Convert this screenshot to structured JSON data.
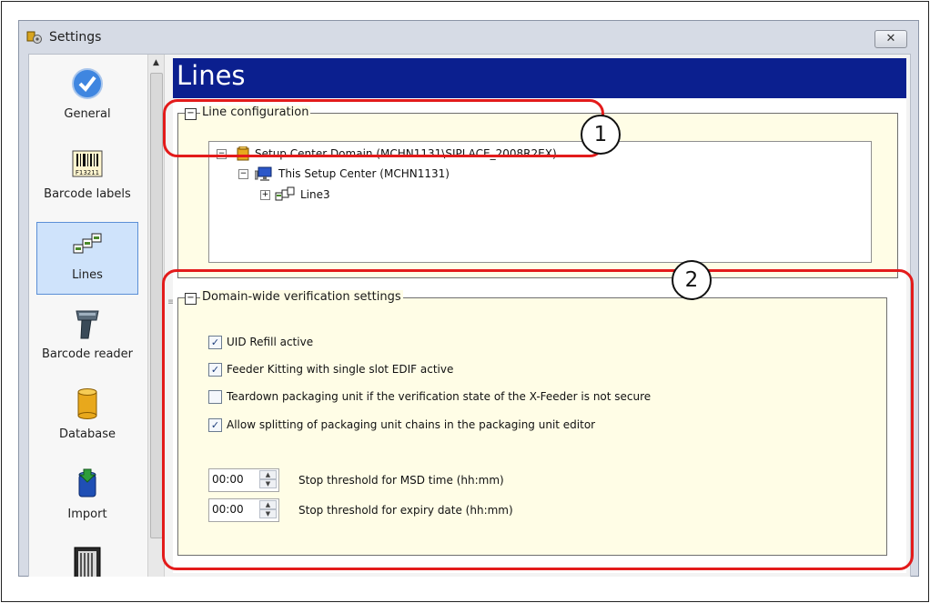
{
  "window": {
    "title": "Settings",
    "close_label": "✕"
  },
  "nav": {
    "items": [
      {
        "label": "General",
        "icon": "check-badge-icon"
      },
      {
        "label": "Barcode labels",
        "icon": "barcode-label-icon",
        "badge_text": "F13211"
      },
      {
        "label": "Lines",
        "icon": "lines-icon",
        "selected": true
      },
      {
        "label": "Barcode reader",
        "icon": "barcode-scanner-icon"
      },
      {
        "label": "Database",
        "icon": "database-icon"
      },
      {
        "label": "Import",
        "icon": "import-icon"
      }
    ]
  },
  "panel": {
    "title": "Lines",
    "line_config": {
      "title": "Line configuration",
      "tree": [
        {
          "label": "Setup Center Domain (MCHN1131\\SIPLACE_2008R2EX)",
          "icon": "domain-icon"
        },
        {
          "label": "This Setup Center (MCHN1131)",
          "icon": "computer-icon"
        },
        {
          "label": "Line3",
          "icon": "line-icon"
        }
      ]
    },
    "verification": {
      "title": "Domain-wide verification settings",
      "checkboxes": [
        {
          "label": "UID Refill active",
          "checked": true
        },
        {
          "label": "Feeder Kitting with single slot EDIF active",
          "checked": true
        },
        {
          "label": "Teardown packaging unit if the verification state of the X-Feeder is not secure",
          "checked": false
        },
        {
          "label": "Allow splitting of packaging unit chains in the packaging unit editor",
          "checked": true
        }
      ],
      "steppers": [
        {
          "value": "00:00",
          "label": "Stop threshold for MSD time (hh:mm)"
        },
        {
          "value": "00:00",
          "label": "Stop threshold for expiry date (hh:mm)"
        }
      ]
    }
  },
  "callouts": [
    {
      "number": "1"
    },
    {
      "number": "2"
    }
  ],
  "colors": {
    "header_bg": "#0b1f8f",
    "group_bg": "#fffde6",
    "callout_red": "#e31b1b",
    "selected_nav": "#cfe3fb"
  }
}
